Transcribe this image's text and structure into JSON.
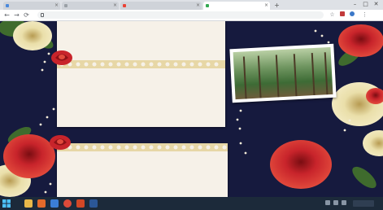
{
  "browser": {
    "tabs": [
      {
        "title": "",
        "favicon_color": "#4a89dc",
        "active": false
      },
      {
        "title": "",
        "favicon_color": "#9aa0a6",
        "active": false
      },
      {
        "title": "",
        "favicon_color": "#ea4335",
        "active": false
      },
      {
        "title": "",
        "favicon_color": "#34a853",
        "active": true
      }
    ],
    "new_tab_glyph": "+",
    "window_controls": {
      "minimize": "–",
      "maximize": "□",
      "close": "✕"
    },
    "address_url": "",
    "nav_glyphs": {
      "back": "←",
      "forward": "→",
      "reload": "⟳"
    }
  },
  "slide": {
    "background_color": "#161a3e",
    "card_color": "#f6f1e8",
    "rose_color": "#c8242b",
    "peony_color": "#eadfaa",
    "leaf_color": "#3f6b2d",
    "top_caption": "",
    "top_caption_color": "#c1262a",
    "bottom_caption": "",
    "bottom_link": "",
    "link_color": "#d93a2a",
    "photo_icon": "forest-photo"
  },
  "taskbar": {
    "color": "#1c2a3a",
    "pinned_apps": [
      {
        "name": "explorer-icon",
        "color": "#e8b84a"
      },
      {
        "name": "media-icon",
        "color": "#e46a2b"
      },
      {
        "name": "browser-icon",
        "color": "#3b7ed6"
      },
      {
        "name": "chrome-icon",
        "color": "#dd4b39"
      },
      {
        "name": "powerpoint-icon",
        "color": "#d24726"
      },
      {
        "name": "word-icon",
        "color": "#2b5797"
      }
    ]
  }
}
